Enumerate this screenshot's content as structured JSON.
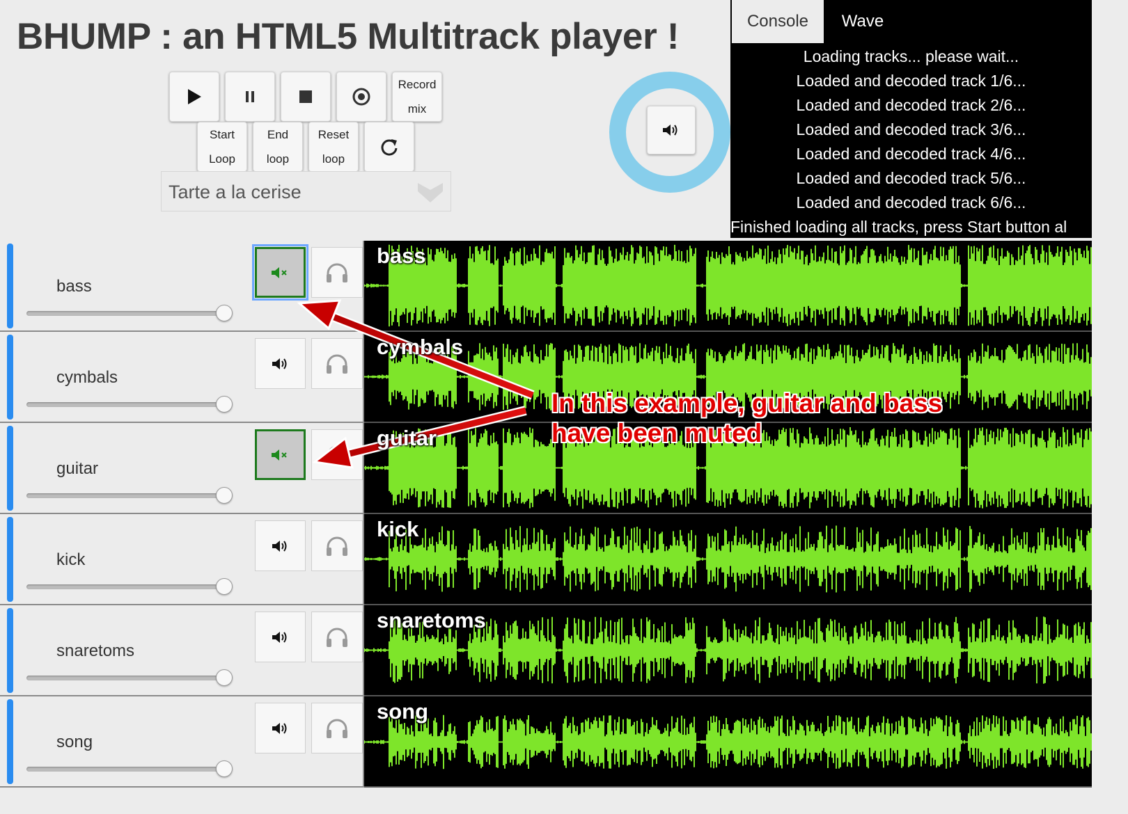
{
  "app": {
    "title": "BHUMP : an HTML5 Multitrack player !"
  },
  "transport": {
    "play_icon": "play-icon",
    "pause_icon": "pause-icon",
    "stop_icon": "stop-icon",
    "record_icon": "record-icon",
    "record_mix_line1": "Record",
    "record_mix_line2": "mix",
    "start_loop_line1": "Start",
    "start_loop_line2": "Loop",
    "end_loop_line1": "End",
    "end_loop_line2": "loop",
    "reset_loop_line1": "Reset",
    "reset_loop_line2": "loop",
    "reload_icon": "reload-icon"
  },
  "song_select": {
    "selected": "Tarte a la cerise"
  },
  "master": {
    "icon": "speaker-icon",
    "ring_color": "#87ceeb"
  },
  "tabs": [
    {
      "label": "Console",
      "active": true
    },
    {
      "label": "Wave",
      "active": false
    }
  ],
  "console": {
    "lines": [
      "Loading tracks... please wait...",
      "Loaded and decoded track 1/6...",
      "Loaded and decoded track 2/6...",
      "Loaded and decoded track 3/6...",
      "Loaded and decoded track 4/6...",
      "Loaded and decoded track 5/6...",
      "Loaded and decoded track 6/6...",
      "Finished loading all tracks, press Start button al"
    ]
  },
  "tracks": [
    {
      "name": "bass",
      "muted": true,
      "volume": 1.0
    },
    {
      "name": "cymbals",
      "muted": false,
      "volume": 1.0
    },
    {
      "name": "guitar",
      "muted": true,
      "volume": 1.0
    },
    {
      "name": "kick",
      "muted": false,
      "volume": 1.0
    },
    {
      "name": "snaretoms",
      "muted": false,
      "volume": 1.0
    },
    {
      "name": "song",
      "muted": false,
      "volume": 1.0
    }
  ],
  "colors": {
    "waveform": "#7ee52a",
    "accent": "#2a8cf0",
    "muted_border": "#1d7a1d",
    "annotation": "#e00000"
  },
  "annotation": {
    "line1": "In this example, guitar and bass",
    "line2": "have been muted"
  }
}
